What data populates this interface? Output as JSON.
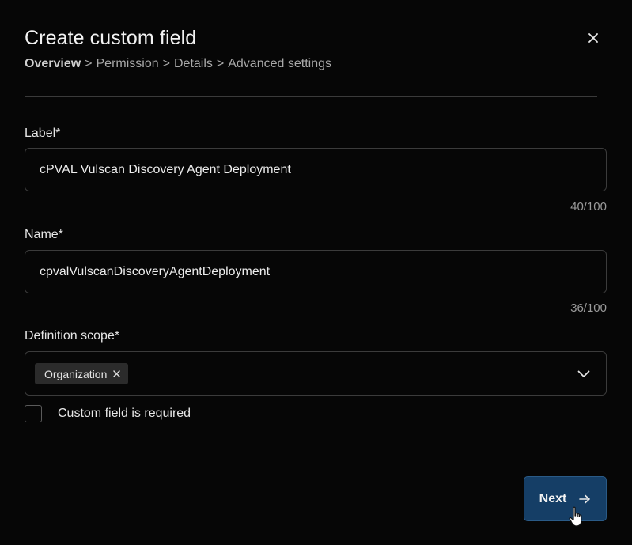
{
  "dialog": {
    "title": "Create custom field",
    "close_icon": "close-icon"
  },
  "breadcrumb": {
    "items": [
      "Overview",
      "Permission",
      "Details",
      "Advanced settings"
    ],
    "separator": ">",
    "current_index": 0
  },
  "form": {
    "label_field": {
      "label": "Label*",
      "value": "cPVAL Vulscan Discovery Agent Deployment",
      "counter": "40/100"
    },
    "name_field": {
      "label": "Name*",
      "value": "cpvalVulscanDiscoveryAgentDeployment",
      "counter": "36/100"
    },
    "definition_scope": {
      "label": "Definition scope*",
      "selected_chip": "Organization",
      "chip_remove_icon": "close-icon",
      "dropdown_icon": "chevron-down-icon"
    },
    "required_checkbox": {
      "label": "Custom field is required",
      "checked": false
    }
  },
  "footer": {
    "next_label": "Next",
    "next_icon": "arrow-right-icon"
  },
  "colors": {
    "background": "#060606",
    "primary_button": "#153e66",
    "border": "#3b3b3b"
  }
}
